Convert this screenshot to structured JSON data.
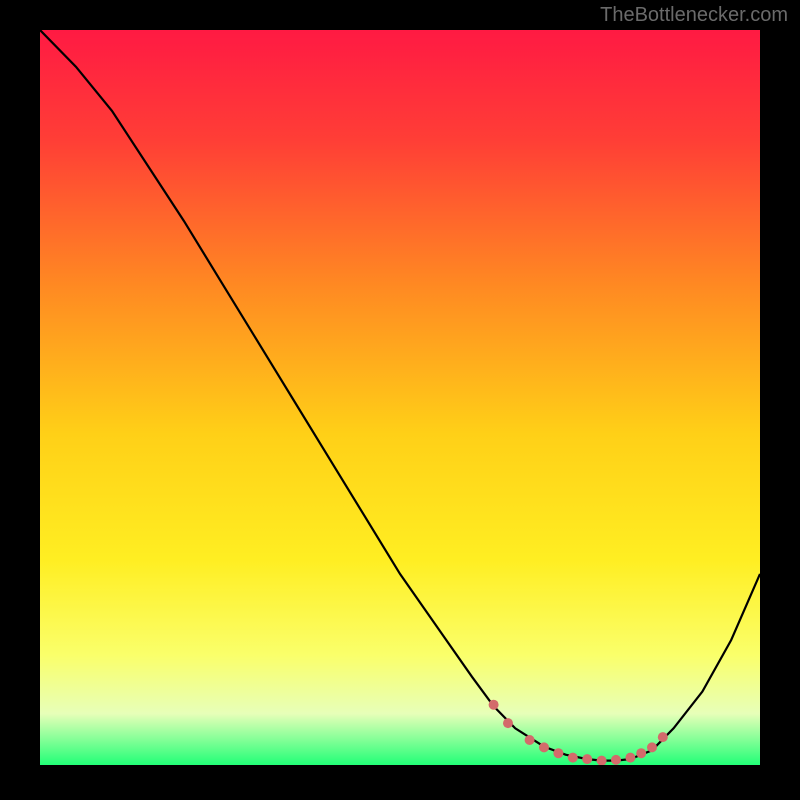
{
  "watermark": "TheBottlenecker.com",
  "chart_data": {
    "type": "line",
    "title": "",
    "xlabel": "",
    "ylabel": "",
    "xlim": [
      0,
      100
    ],
    "ylim": [
      0,
      100
    ],
    "background_gradient": {
      "stops": [
        {
          "pos": 0.0,
          "color": "#ff1a43"
        },
        {
          "pos": 0.15,
          "color": "#ff3e36"
        },
        {
          "pos": 0.35,
          "color": "#ff8a22"
        },
        {
          "pos": 0.55,
          "color": "#ffd017"
        },
        {
          "pos": 0.72,
          "color": "#ffee22"
        },
        {
          "pos": 0.85,
          "color": "#faff6a"
        },
        {
          "pos": 0.93,
          "color": "#e7ffb8"
        },
        {
          "pos": 1.0,
          "color": "#22ff77"
        }
      ]
    },
    "series": [
      {
        "name": "bottleneck-curve",
        "x": [
          0,
          5,
          10,
          15,
          20,
          25,
          30,
          35,
          40,
          45,
          50,
          55,
          60,
          63,
          66,
          70,
          73,
          76,
          78,
          80,
          82,
          85,
          88,
          92,
          96,
          100
        ],
        "y": [
          100,
          95,
          89,
          81.5,
          74,
          66,
          58,
          50,
          42,
          34,
          26,
          19,
          12,
          8,
          5,
          2.5,
          1.4,
          0.8,
          0.6,
          0.6,
          0.8,
          2,
          5,
          10,
          17,
          26
        ],
        "color": "#000000",
        "width": 2.2
      }
    ],
    "markers": {
      "name": "highlight-dots",
      "color": "#d36b6b",
      "radius": 5,
      "points": [
        {
          "x": 63,
          "y": 8.2
        },
        {
          "x": 65,
          "y": 5.7
        },
        {
          "x": 68,
          "y": 3.4
        },
        {
          "x": 70,
          "y": 2.4
        },
        {
          "x": 72,
          "y": 1.6
        },
        {
          "x": 74,
          "y": 1.0
        },
        {
          "x": 76,
          "y": 0.8
        },
        {
          "x": 78,
          "y": 0.6
        },
        {
          "x": 80,
          "y": 0.7
        },
        {
          "x": 82,
          "y": 1.0
        },
        {
          "x": 83.5,
          "y": 1.6
        },
        {
          "x": 85,
          "y": 2.4
        },
        {
          "x": 86.5,
          "y": 3.8
        }
      ]
    }
  }
}
